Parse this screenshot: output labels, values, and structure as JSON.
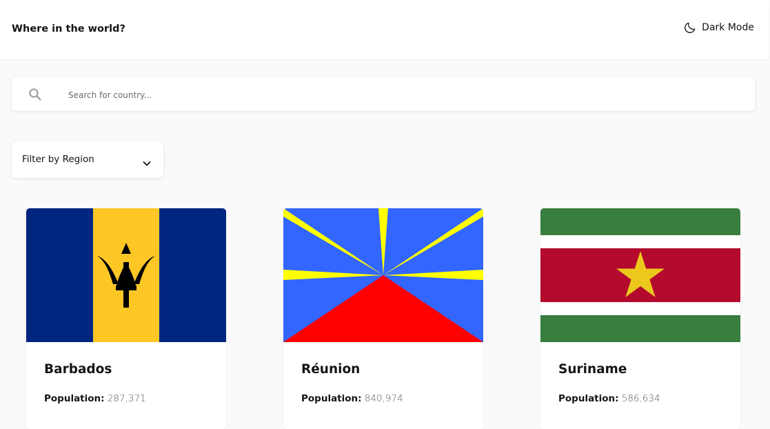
{
  "header": {
    "title": "Where in the world?",
    "theme_toggle_label": "Dark Mode",
    "theme_icon": "moon-icon"
  },
  "search": {
    "placeholder": "Search for country...",
    "value": "",
    "icon": "search-icon"
  },
  "filter": {
    "label": "Filter by Region",
    "icon": "chevron-down-icon"
  },
  "countries": [
    {
      "name": "Barbados",
      "population_label": "Population:",
      "population": "287,371",
      "flag": "barbados-flag",
      "colors": [
        "#00267f",
        "#ffc726",
        "#000000"
      ]
    },
    {
      "name": "Réunion",
      "population_label": "Population:",
      "population": "840,974",
      "flag": "reunion-flag",
      "colors": [
        "#3366ff",
        "#ffff00",
        "#ff0000"
      ]
    },
    {
      "name": "Suriname",
      "population_label": "Population:",
      "population": "586,634",
      "flag": "suriname-flag",
      "colors": [
        "#377e3f",
        "#ffffff",
        "#b40a2d",
        "#ecc81d"
      ]
    }
  ]
}
